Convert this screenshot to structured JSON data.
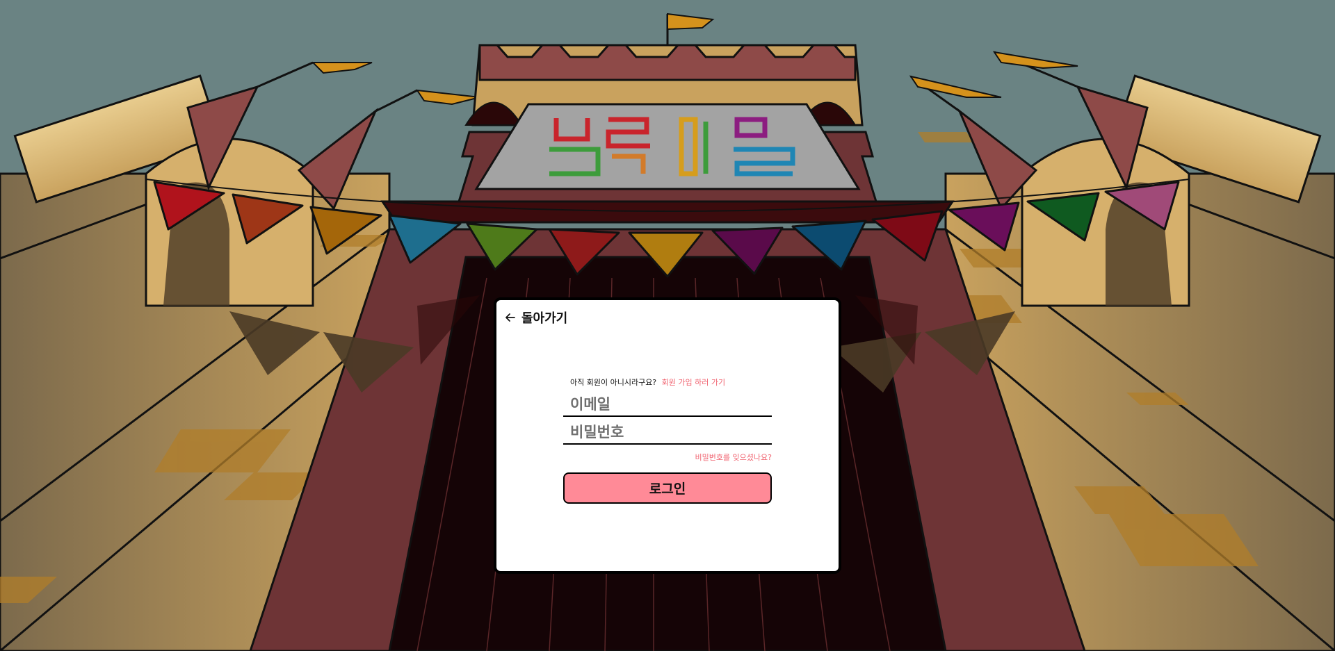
{
  "background": {
    "sign_text": "블록마을",
    "colors": {
      "sky": "#6a8383",
      "wall": "#c9a25e",
      "roof": "#6e3436",
      "door": "#150406"
    }
  },
  "login_modal": {
    "back_label": "돌아가기",
    "back_icon": "arrow-left-icon",
    "signup_prompt": "아직 회원이 아니시라구요?",
    "signup_link": "회원 가입 하러 가기",
    "email_placeholder": "이메일",
    "password_placeholder": "비밀번호",
    "forgot_password": "비밀번호를 잊으셨나요?",
    "login_button": "로그인",
    "accent_color": "#ff8a97"
  }
}
